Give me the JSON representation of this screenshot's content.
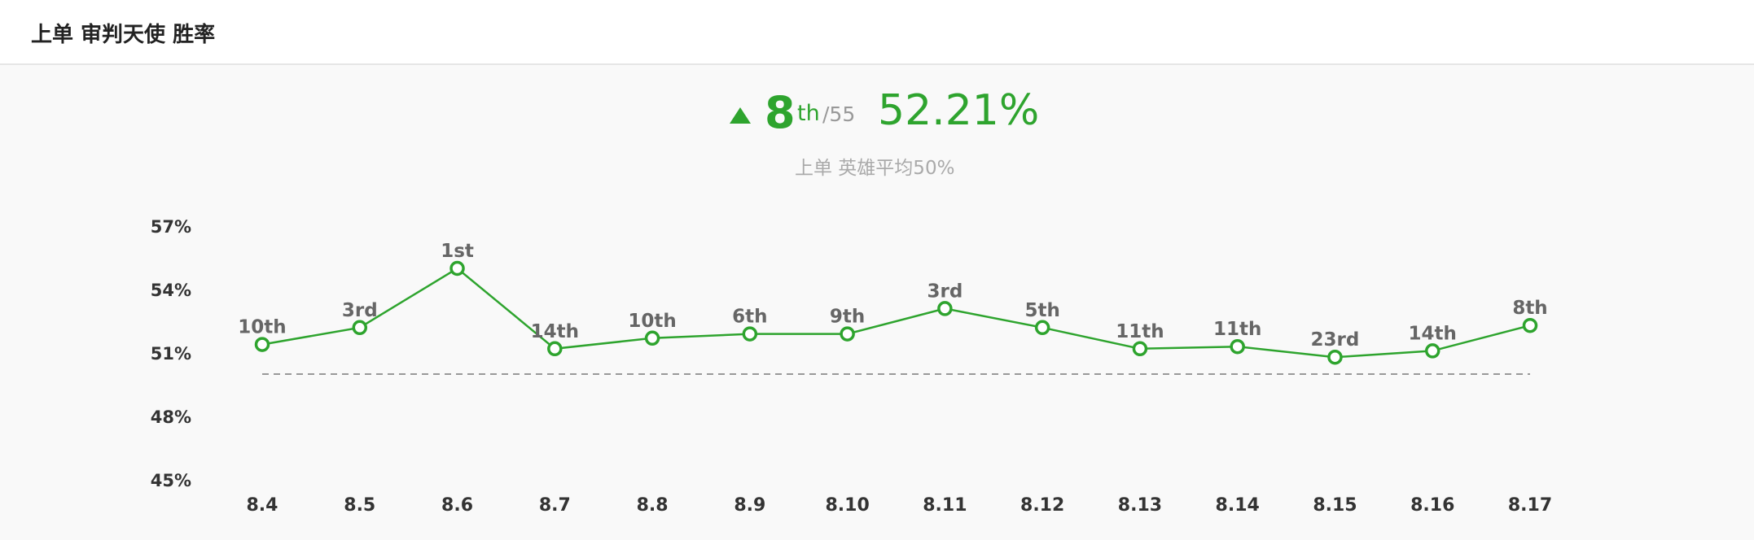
{
  "header": {
    "title": "上单 审判天使 胜率"
  },
  "summary": {
    "trend_icon": "up-triangle-icon",
    "rank": "8",
    "rank_suffix": "th",
    "rank_total": "/55",
    "win_rate": "52.21%",
    "subtitle": "上单 英雄平均50%"
  },
  "colors": {
    "line": "#2ea42e",
    "baseline": "#999999",
    "text_dark": "#333333",
    "text_rank": "#666666"
  },
  "chart_data": {
    "type": "line",
    "title": "",
    "xlabel": "",
    "ylabel": "",
    "categories": [
      "8.4",
      "8.5",
      "8.6",
      "8.7",
      "8.8",
      "8.9",
      "8.10",
      "8.11",
      "8.12",
      "8.13",
      "8.14",
      "8.15",
      "8.16",
      "8.17"
    ],
    "series": [
      {
        "values": [
          51.4,
          52.2,
          55.0,
          51.2,
          51.7,
          51.9,
          51.9,
          53.1,
          52.2,
          51.2,
          51.3,
          50.8,
          51.1,
          52.3
        ],
        "rank_labels": [
          "10th",
          "3rd",
          "1st",
          "14th",
          "10th",
          "6th",
          "9th",
          "3rd",
          "5th",
          "11th",
          "11th",
          "23rd",
          "14th",
          "8th"
        ]
      }
    ],
    "baseline_value": 50,
    "ylim": [
      45,
      57
    ],
    "y_ticks": [
      57,
      54,
      51,
      48,
      45
    ],
    "y_tick_labels": [
      "57%",
      "54%",
      "51%",
      "48%",
      "45%"
    ],
    "grid": false,
    "legend": "none"
  }
}
